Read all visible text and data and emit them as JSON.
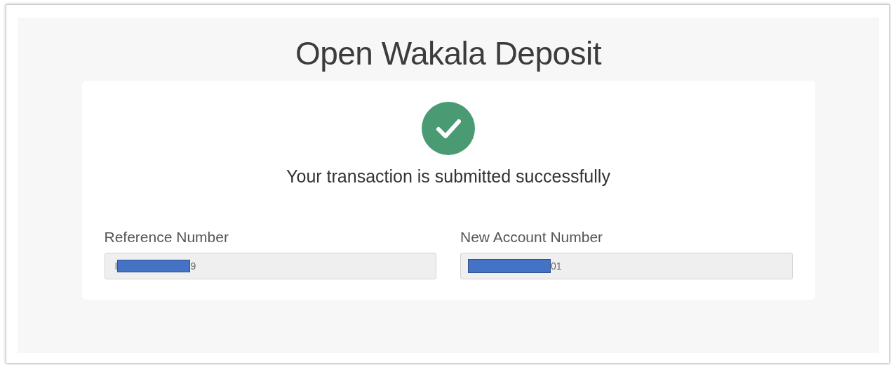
{
  "page": {
    "title": "Open Wakala Deposit"
  },
  "confirmation": {
    "success": true,
    "message": "Your transaction is submitted successfully"
  },
  "fields": [
    {
      "label": "Reference Number",
      "visible_start": "I",
      "visible_end": "9",
      "redacted": true
    },
    {
      "label": "New Account Number",
      "visible_end": "01",
      "redacted": true
    }
  ]
}
